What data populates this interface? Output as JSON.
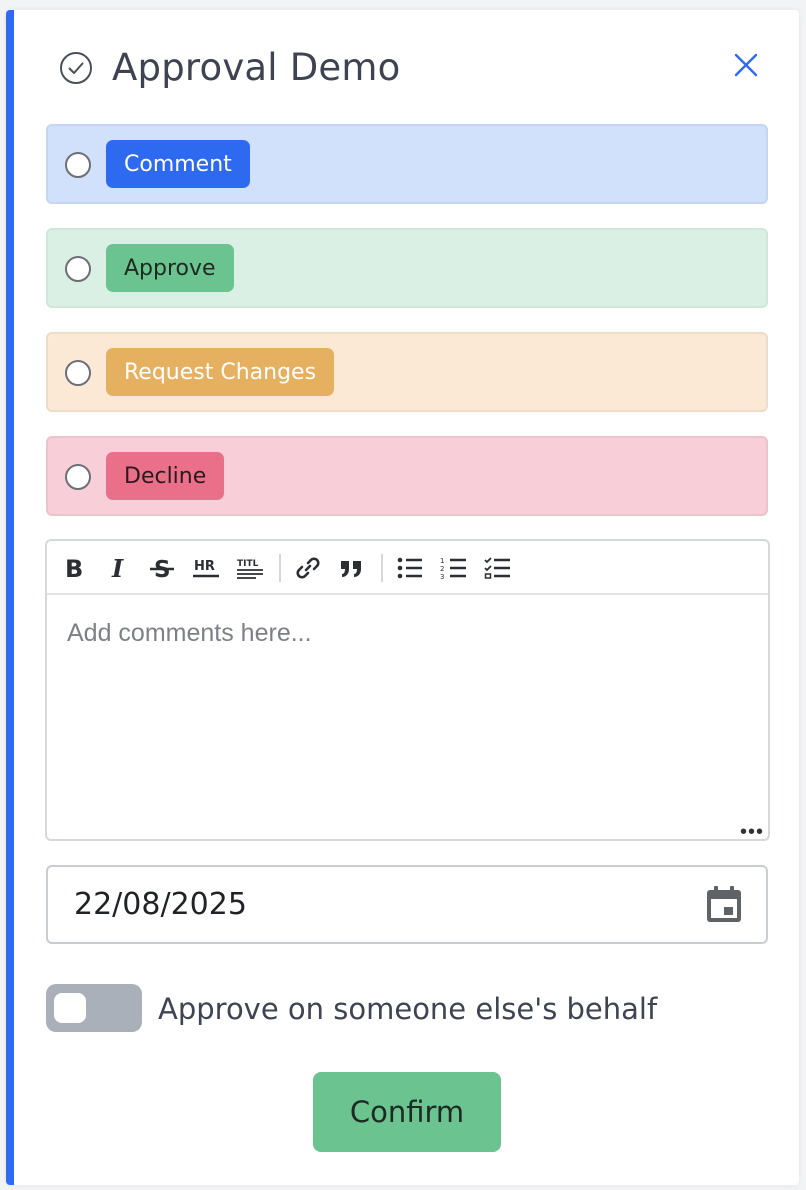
{
  "header": {
    "title": "Approval Demo",
    "title_icon": "check-circle-icon",
    "close_icon": "close-icon"
  },
  "options": [
    {
      "label": "Comment",
      "selected": false,
      "color": "#2d6af0"
    },
    {
      "label": "Approve",
      "selected": false,
      "color": "#6bc490"
    },
    {
      "label": "Request Changes",
      "selected": false,
      "color": "#e6b061"
    },
    {
      "label": "Decline",
      "selected": false,
      "color": "#ea6f89"
    }
  ],
  "editor": {
    "toolbar": [
      {
        "name": "bold-icon",
        "glyph": "B"
      },
      {
        "name": "italic-icon",
        "glyph": "I"
      },
      {
        "name": "strikethrough-icon",
        "glyph": "S"
      },
      {
        "name": "horizontal-rule-icon",
        "glyph": "HR"
      },
      {
        "name": "heading-icon",
        "glyph": "TITL"
      },
      {
        "name": "link-icon"
      },
      {
        "name": "quote-icon"
      },
      {
        "name": "bullet-list-icon"
      },
      {
        "name": "numbered-list-icon"
      },
      {
        "name": "checklist-icon"
      }
    ],
    "placeholder": "Add comments here...",
    "value": ""
  },
  "date": {
    "value": "22/08/2025",
    "icon": "calendar-icon"
  },
  "toggle": {
    "label": "Approve on someone else's behalf",
    "on": false
  },
  "confirm_label": "Confirm",
  "colors": {
    "accent": "#2f6bf0",
    "confirm": "#6bc490"
  }
}
